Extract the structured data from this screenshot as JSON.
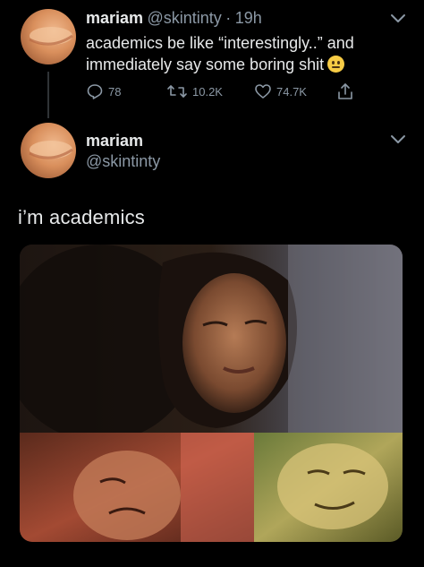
{
  "first_tweet": {
    "name": "mariam",
    "handle": "@skintinty",
    "separator": "·",
    "time": "19h",
    "text": "academics be like “interestingly..” and immediately say some boring shit",
    "emoji": "neutral-face-emoji",
    "actions": {
      "replies": "78",
      "retweets": "10.2K",
      "likes": "74.7K"
    }
  },
  "reply_tweet": {
    "name": "mariam",
    "handle": "@skintinty",
    "text": "i’m academics"
  },
  "icons": {
    "reply": "reply-icon",
    "retweet": "retweet-icon",
    "like": "heart-icon",
    "share": "share-icon",
    "menu": "chevron-down-icon"
  },
  "colors": {
    "background": "#000000",
    "text": "#e7e9ea",
    "secondary": "#8b98a5"
  }
}
